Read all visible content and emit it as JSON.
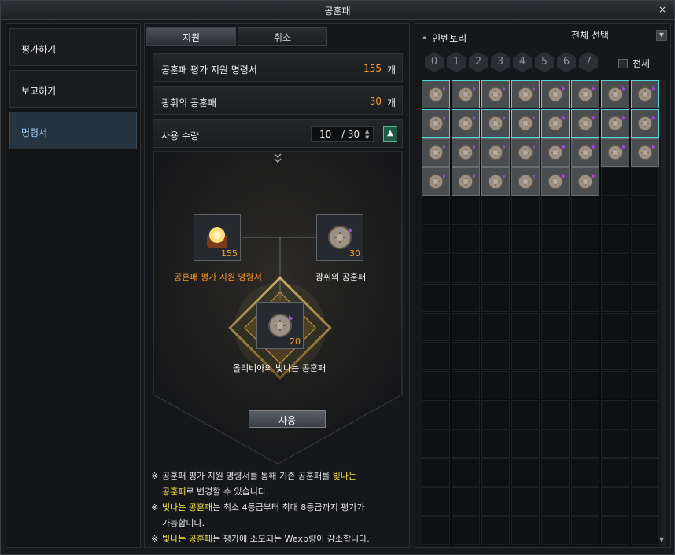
{
  "window": {
    "title": "공훈패",
    "close": "×"
  },
  "sidebar": {
    "items": [
      {
        "label": "평가하기"
      },
      {
        "label": "보고하기"
      },
      {
        "label": "명령서"
      }
    ]
  },
  "tabs": [
    {
      "label": "지원"
    },
    {
      "label": "취소"
    }
  ],
  "rows": {
    "order": {
      "label": "공훈패 평가 지원 명령서",
      "count": "155",
      "unit": "개"
    },
    "medal": {
      "label": "광휘의 공훈패",
      "count": "30",
      "unit": "개"
    },
    "qty": {
      "label": "사용 수량",
      "current": "10",
      "max": "/ 30"
    }
  },
  "craft": {
    "input1": {
      "label": "공훈패 평가 지원 명령서",
      "count": "155"
    },
    "input2": {
      "label": "광휘의 공훈패",
      "count": "30"
    },
    "output": {
      "label": "올리비아의 빛나는 공훈패",
      "count": "20"
    },
    "use_button": "사용"
  },
  "notes": {
    "mark": "※",
    "line1_a": "공훈패 평가 지원 명령서를 통해 기존 공훈패를 ",
    "line1_hl": "빛나는",
    "line2_hl": "공훈패",
    "line2_b": "로 변경할 수 있습니다.",
    "line3_hl": "빛나는 공훈패",
    "line3_b": "는 최소 4등급부터 최대 8등급까지 평가가",
    "line4": "가능합니다.",
    "line5_hl": "빛나는 공훈패",
    "line5_b": "는 평가에 소모되는 Wexp량이 감소합니다."
  },
  "inventory": {
    "title": "인벤토리",
    "select": "전체 선택",
    "tabs": [
      "0",
      "1",
      "2",
      "3",
      "4",
      "5",
      "6",
      "7"
    ],
    "all_label": "전체",
    "columns": 8,
    "rows": 16,
    "filled": 30,
    "highlighted": 16
  }
}
